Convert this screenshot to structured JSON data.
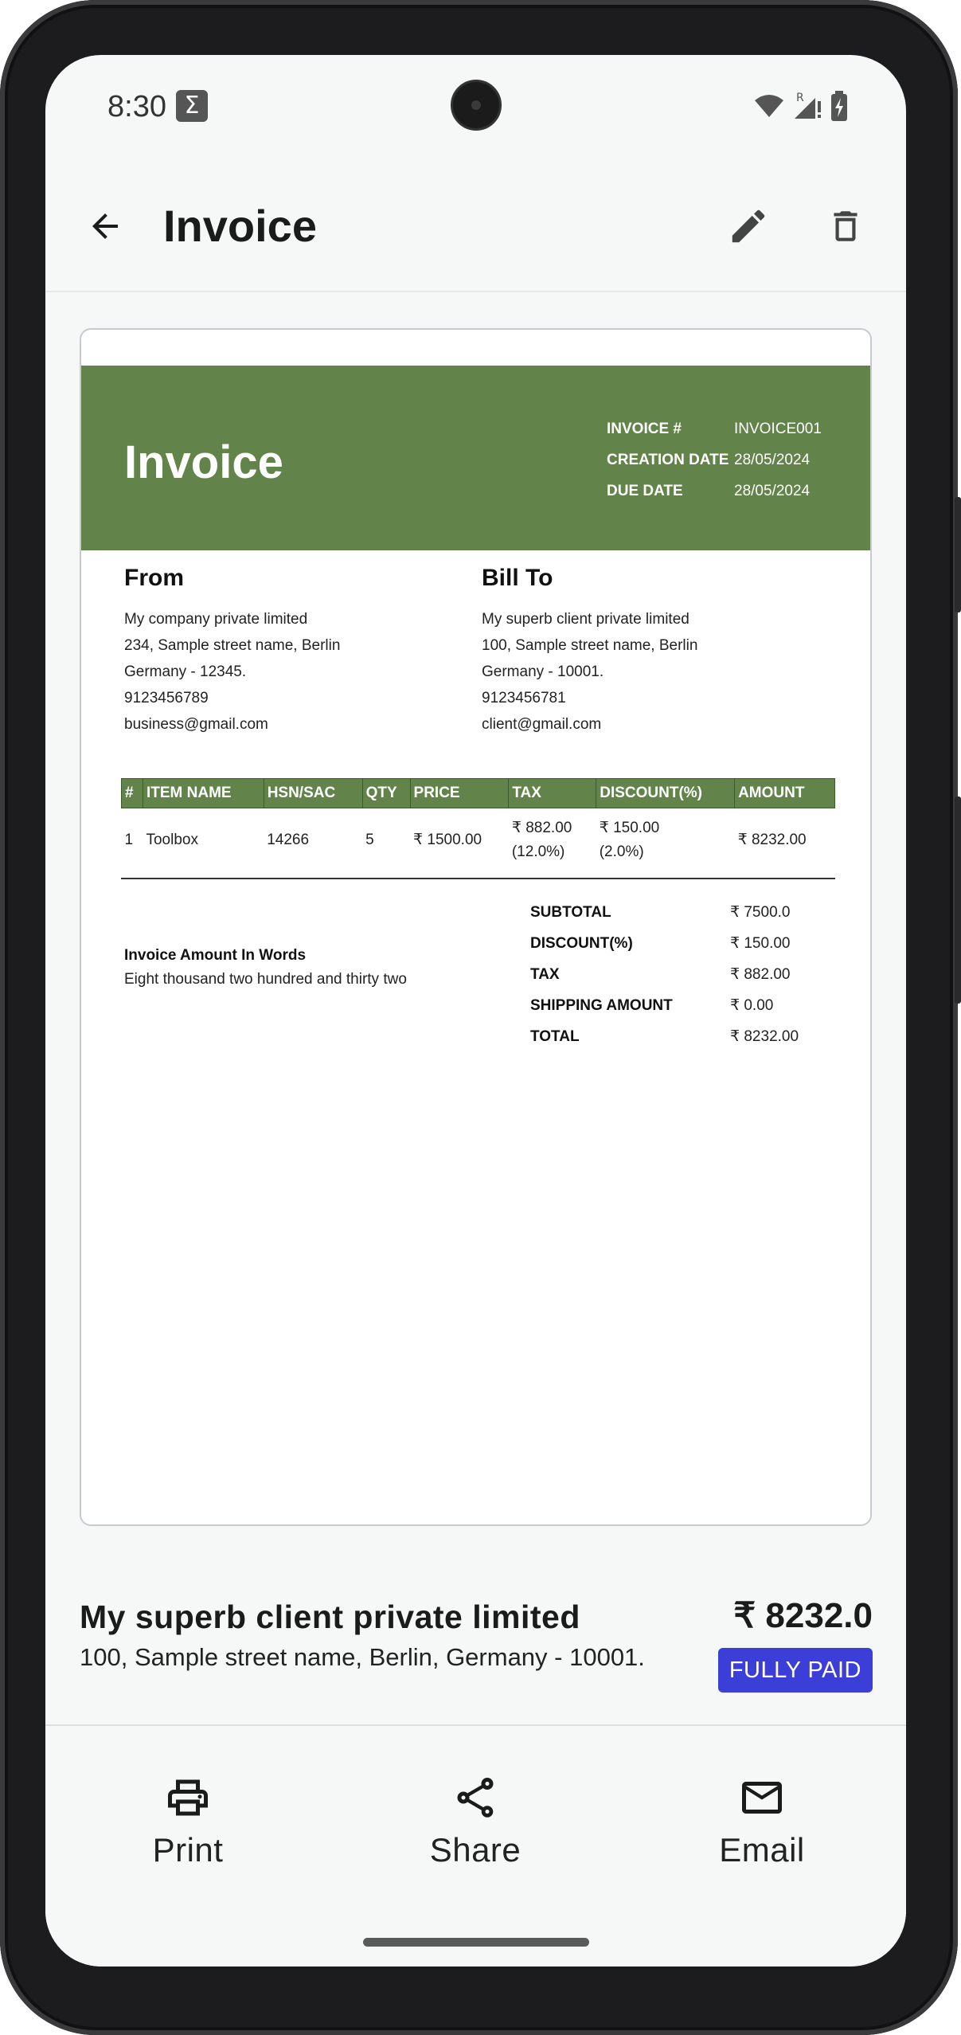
{
  "status_bar": {
    "time": "8:30",
    "notification_icon": "sigma-icon",
    "icons": [
      "wifi-icon",
      "signal-roaming-icon",
      "battery-charging-icon"
    ]
  },
  "app_bar": {
    "title": "Invoice",
    "back_icon": "arrow-back-icon",
    "edit_icon": "pencil-icon",
    "delete_icon": "trash-icon"
  },
  "invoice": {
    "header_color": "#62834a",
    "title": "Invoice",
    "meta": [
      {
        "label": "INVOICE #",
        "value": "INVOICE001"
      },
      {
        "label": "CREATION DATE",
        "value": "28/05/2024"
      },
      {
        "label": "DUE DATE",
        "value": "28/05/2024"
      }
    ],
    "from": {
      "heading": "From",
      "lines": [
        "My company private limited",
        "234, Sample street name, Berlin",
        "Germany - 12345.",
        "9123456789",
        "business@gmail.com"
      ]
    },
    "bill_to": {
      "heading": "Bill To",
      "lines": [
        "My superb client private limited",
        "100, Sample street name, Berlin",
        "Germany - 10001.",
        "9123456781",
        "client@gmail.com"
      ]
    },
    "table": {
      "headers": [
        "#",
        "ITEM NAME",
        "HSN/SAC",
        "QTY",
        "PRICE",
        "TAX",
        "DISCOUNT(%)",
        "AMOUNT"
      ],
      "rows": [
        {
          "num": "1",
          "item": "Toolbox",
          "hsn": "14266",
          "qty": "5",
          "price": "₹ 1500.00",
          "tax": "₹ 882.00",
          "tax_pct": "(12.0%)",
          "discount": "₹ 150.00",
          "discount_pct": "(2.0%)",
          "amount": "₹ 8232.00"
        }
      ]
    },
    "amount_in_words": {
      "title": "Invoice Amount In Words",
      "value": "Eight thousand two hundred and thirty two"
    },
    "totals": [
      {
        "label": "SUBTOTAL",
        "value": "₹ 7500.0"
      },
      {
        "label": "DISCOUNT(%)",
        "value": "₹ 150.00"
      },
      {
        "label": "TAX",
        "value": "₹ 882.00"
      },
      {
        "label": "SHIPPING AMOUNT",
        "value": "₹ 0.00"
      },
      {
        "label": "TOTAL",
        "value": "₹ 8232.00"
      }
    ]
  },
  "summary": {
    "client_name": "My superb client private limited",
    "client_address": "100, Sample street name, Berlin, Germany - 10001.",
    "total": "₹ 8232.0",
    "status": "FULLY PAID",
    "status_color": "#3b3fd8"
  },
  "actions": [
    {
      "label": "Print",
      "icon": "printer-icon"
    },
    {
      "label": "Share",
      "icon": "share-icon"
    },
    {
      "label": "Email",
      "icon": "mail-icon"
    }
  ]
}
